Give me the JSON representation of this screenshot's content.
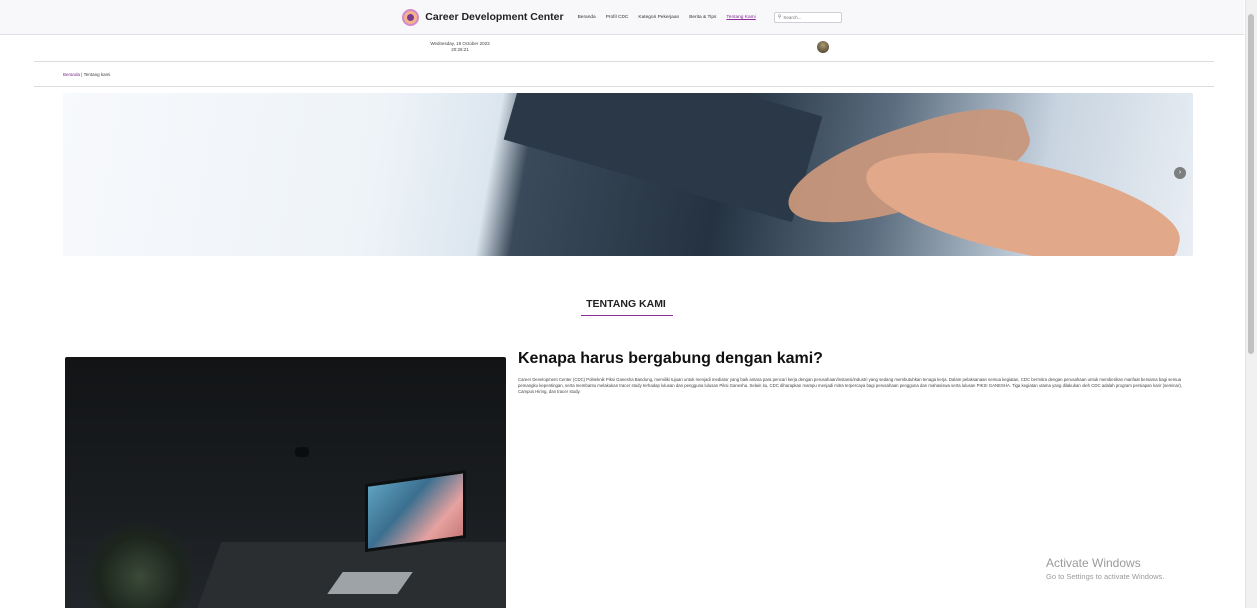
{
  "header": {
    "brand": "Career Development Center",
    "nav": [
      {
        "label": "Beranda",
        "active": false
      },
      {
        "label": "Profil CDC",
        "active": false
      },
      {
        "label": "Kategori Pekerjaan",
        "active": false
      },
      {
        "label": "Berita & Tips",
        "active": false
      },
      {
        "label": "Tentang Kami",
        "active": true
      }
    ],
    "search_placeholder": "Search..."
  },
  "datetime": {
    "date": "Wednesday, 18 October 2023",
    "time": "20:26:21"
  },
  "breadcrumb": {
    "home": "Beranda",
    "separator": " | ",
    "current": "Tentang kami"
  },
  "section": {
    "title": "TENTANG KAMI",
    "heading": "Kenapa harus bergabung dengan kami?",
    "body": "Career Development Center (CDC) Politeknik Piksi Ganesha Bandung, memiliki tujuan untuk menjadi mediator yang baik antara para pencari kerja dengan perusahaan/instansi/industri yang sedang membutuhkan tenaga kerja. Dalam pelaksanaan semua kegiatan, CDC bermitra dengan perusahaan untuk memberikan manfaat bersama bagi semua pemangku kepentingan, serta membantu melakukan tracer study terhadap lulusan dan pengguna lulusan Piksi Ganesha. Selain itu, CDC diharapkan mampu menjadi mitra terpercaya bagi perusahaan pengguna dan mahasiswa serta lulusan PIKSI GANESHA. Tiga kegiatan utama yang dilakukan oleh CDC adalah program persiapan karir (seminar), Campus Hiring, dan tracer study."
  },
  "watermark": {
    "line1": "Activate Windows",
    "line2": "Go to Settings to activate Windows."
  },
  "icons": {
    "search": "search-icon",
    "next": "chevron-right-icon"
  },
  "colors": {
    "accent": "#8a2d99",
    "header_bg": "#f8f8fa"
  }
}
